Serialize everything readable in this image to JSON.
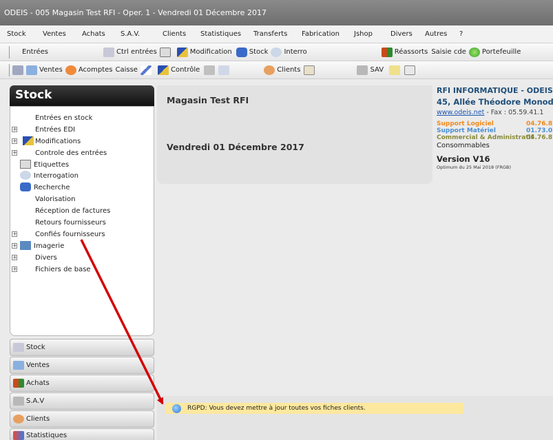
{
  "window": {
    "title": "ODEIS - 005 Magasin Test RFI - Oper. 1 - Vendredi 01 Décembre 2017"
  },
  "menu": [
    {
      "label": "Stock"
    },
    {
      "label": "Ventes"
    },
    {
      "label": "Achats"
    },
    {
      "label": "S.A.V."
    },
    {
      "label": "Clients"
    },
    {
      "label": "Statistiques"
    },
    {
      "label": "Transferts"
    },
    {
      "label": "Fabrication"
    },
    {
      "label": "Jshop"
    },
    {
      "label": "Divers"
    },
    {
      "label": "Autres"
    },
    {
      "label": "?"
    }
  ],
  "toolbar1": {
    "entrees": "Entrées",
    "ctrl_entrees": "Ctrl entrées",
    "modification": "Modification",
    "stock": "Stock",
    "interro": "Interro",
    "reassorts": "Réassorts",
    "saisie_cde": "Saisie cde",
    "portefeuille": "Portefeuille"
  },
  "toolbar2": {
    "ventes": "Ventes",
    "acomptes": "Acomptes",
    "caisse": "Caisse",
    "controle": "Contrôle",
    "clients": "Clients",
    "sav": "SAV"
  },
  "sidebar": {
    "header": "Stock",
    "tree": [
      {
        "label": "Entrées en stock",
        "expand": false
      },
      {
        "label": "Entrées EDI",
        "expand": true
      },
      {
        "label": "Modifications",
        "expand": true
      },
      {
        "label": "Controle des entrées",
        "expand": true
      },
      {
        "label": "Etiquettes",
        "expand": false
      },
      {
        "label": "Interrogation",
        "expand": false
      },
      {
        "label": "Recherche",
        "expand": false
      },
      {
        "label": "Valorisation",
        "expand": false
      },
      {
        "label": "Réception de factures",
        "expand": false
      },
      {
        "label": "Retours fournisseurs",
        "expand": false
      },
      {
        "label": "Confiés fournisseurs",
        "expand": true
      },
      {
        "label": "Imagerie",
        "expand": true
      },
      {
        "label": "Divers",
        "expand": true
      },
      {
        "label": "Fichiers de base",
        "expand": true
      }
    ],
    "nav": [
      {
        "label": "Stock"
      },
      {
        "label": "Ventes"
      },
      {
        "label": "Achats"
      },
      {
        "label": "S.A.V"
      },
      {
        "label": "Clients"
      },
      {
        "label": "Statistiques"
      }
    ]
  },
  "main": {
    "store_name": "Magasin Test RFI",
    "date": "Vendredi 01 Décembre 2017"
  },
  "info": {
    "company": "RFI INFORMATIQUE - ODEIS",
    "address": "45, Allée Théodore Monod –",
    "website": "www.odeis.net",
    "fax": " - Fax : 05.59.41.1",
    "support_logiciel": "Support Logiciel",
    "support_logiciel_num": "04.76.8",
    "support_materiel": "Support Matériel",
    "support_materiel_num": "01.73.0",
    "commercial": "Commercial & Administratif",
    "commercial_num": "04.76.8",
    "consommables": "Consommables",
    "version": "Version V16",
    "optimum": "Optimum du 25 Mai 2018 (FRGB)",
    "colors": {
      "logiciel": "#f08a1c",
      "materiel": "#4a8fd4",
      "commercial": "#8a8a3a"
    }
  },
  "notice": {
    "text": "RGPD: Vous devez mettre à jour toutes vos fiches clients."
  }
}
